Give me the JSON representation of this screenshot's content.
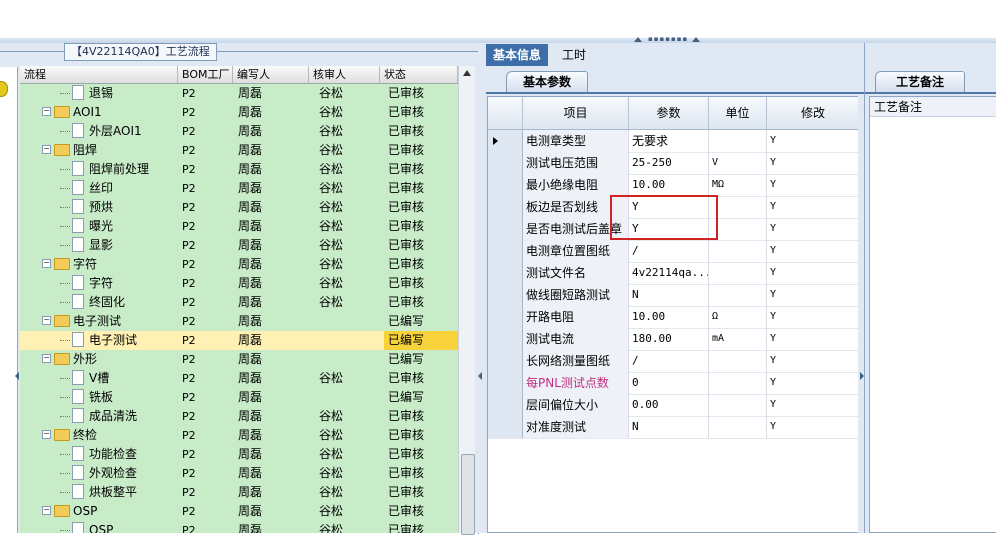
{
  "workflow": {
    "group_title": "【4V22114QA0】工艺流程",
    "columns": [
      "流程",
      "BOM工厂",
      "编写人",
      "核审人",
      "状态"
    ],
    "rows": [
      {
        "indent": 2,
        "kind": "doc",
        "name": "退锡",
        "bom": "P2",
        "writer": "周磊",
        "auditor": "谷松",
        "status": "已审核"
      },
      {
        "indent": 1,
        "kind": "folder",
        "name": "AOI1",
        "bom": "P2",
        "writer": "周磊",
        "auditor": "谷松",
        "status": "已审核"
      },
      {
        "indent": 2,
        "kind": "doc",
        "name": "外层AOI1",
        "bom": "P2",
        "writer": "周磊",
        "auditor": "谷松",
        "status": "已审核"
      },
      {
        "indent": 1,
        "kind": "folder",
        "name": "阻焊",
        "bom": "P2",
        "writer": "周磊",
        "auditor": "谷松",
        "status": "已审核"
      },
      {
        "indent": 2,
        "kind": "doc",
        "name": "阻焊前处理",
        "bom": "P2",
        "writer": "周磊",
        "auditor": "谷松",
        "status": "已审核"
      },
      {
        "indent": 2,
        "kind": "doc",
        "name": "丝印",
        "bom": "P2",
        "writer": "周磊",
        "auditor": "谷松",
        "status": "已审核"
      },
      {
        "indent": 2,
        "kind": "doc",
        "name": "预烘",
        "bom": "P2",
        "writer": "周磊",
        "auditor": "谷松",
        "status": "已审核"
      },
      {
        "indent": 2,
        "kind": "doc",
        "name": "曝光",
        "bom": "P2",
        "writer": "周磊",
        "auditor": "谷松",
        "status": "已审核"
      },
      {
        "indent": 2,
        "kind": "doc",
        "name": "显影",
        "bom": "P2",
        "writer": "周磊",
        "auditor": "谷松",
        "status": "已审核"
      },
      {
        "indent": 1,
        "kind": "folder",
        "name": "字符",
        "bom": "P2",
        "writer": "周磊",
        "auditor": "谷松",
        "status": "已审核"
      },
      {
        "indent": 2,
        "kind": "doc",
        "name": "字符",
        "bom": "P2",
        "writer": "周磊",
        "auditor": "谷松",
        "status": "已审核"
      },
      {
        "indent": 2,
        "kind": "doc",
        "name": "终固化",
        "bom": "P2",
        "writer": "周磊",
        "auditor": "谷松",
        "status": "已审核"
      },
      {
        "indent": 1,
        "kind": "folder",
        "name": "电子测试",
        "bom": "P2",
        "writer": "周磊",
        "auditor": "",
        "status": "已编写"
      },
      {
        "indent": 2,
        "kind": "doc",
        "name": "电子测试",
        "bom": "P2",
        "writer": "周磊",
        "auditor": "",
        "status": "已编写",
        "selected": true
      },
      {
        "indent": 1,
        "kind": "folder",
        "name": "外形",
        "bom": "P2",
        "writer": "周磊",
        "auditor": "",
        "status": "已编写"
      },
      {
        "indent": 2,
        "kind": "doc",
        "name": "V槽",
        "bom": "P2",
        "writer": "周磊",
        "auditor": "谷松",
        "status": "已审核"
      },
      {
        "indent": 2,
        "kind": "doc",
        "name": "铣板",
        "bom": "P2",
        "writer": "周磊",
        "auditor": "",
        "status": "已编写"
      },
      {
        "indent": 2,
        "kind": "doc",
        "name": "成品清洗",
        "bom": "P2",
        "writer": "周磊",
        "auditor": "谷松",
        "status": "已审核"
      },
      {
        "indent": 1,
        "kind": "folder",
        "name": "终检",
        "bom": "P2",
        "writer": "周磊",
        "auditor": "谷松",
        "status": "已审核"
      },
      {
        "indent": 2,
        "kind": "doc",
        "name": "功能检查",
        "bom": "P2",
        "writer": "周磊",
        "auditor": "谷松",
        "status": "已审核"
      },
      {
        "indent": 2,
        "kind": "doc",
        "name": "外观检查",
        "bom": "P2",
        "writer": "周磊",
        "auditor": "谷松",
        "status": "已审核"
      },
      {
        "indent": 2,
        "kind": "doc",
        "name": "烘板整平",
        "bom": "P2",
        "writer": "周磊",
        "auditor": "谷松",
        "status": "已审核"
      },
      {
        "indent": 1,
        "kind": "folder",
        "name": "OSP",
        "bom": "P2",
        "writer": "周磊",
        "auditor": "谷松",
        "status": "已审核"
      },
      {
        "indent": 2,
        "kind": "doc",
        "name": "OSP",
        "bom": "P2",
        "writer": "周磊",
        "auditor": "谷松",
        "status": "已审核"
      }
    ]
  },
  "tabs": {
    "basic_info": "基本信息",
    "work_hours": "工时"
  },
  "params": {
    "subtab": "基本参数",
    "columns": [
      "项目",
      "参数",
      "单位",
      "修改"
    ],
    "rows": [
      {
        "item": "电测章类型",
        "param": "无要求",
        "unit": "",
        "mod": "Y",
        "current": true,
        "cn": true
      },
      {
        "item": "测试电压范围",
        "param": "25-250",
        "unit": "V",
        "mod": "Y"
      },
      {
        "item": "最小绝缘电阻",
        "param": "10.00",
        "unit": "MΩ",
        "mod": "Y"
      },
      {
        "item": "板边是否划线",
        "param": "Y",
        "unit": "",
        "mod": "Y"
      },
      {
        "item": "是否电测试后盖章",
        "param": "Y",
        "unit": "",
        "mod": "Y"
      },
      {
        "item": "电测章位置图纸",
        "param": "/",
        "unit": "",
        "mod": "Y"
      },
      {
        "item": "测试文件名",
        "param": "4v22114qa...",
        "unit": "",
        "mod": "Y"
      },
      {
        "item": "做线圈短路测试",
        "param": "N",
        "unit": "",
        "mod": "Y"
      },
      {
        "item": "开路电阻",
        "param": "10.00",
        "unit": "Ω",
        "mod": "Y"
      },
      {
        "item": "测试电流",
        "param": "180.00",
        "unit": "mA",
        "mod": "Y"
      },
      {
        "item": "长网络测量图纸",
        "param": "/",
        "unit": "",
        "mod": "Y"
      },
      {
        "item": "每PNL测试点数",
        "param": "0",
        "unit": "",
        "mod": "Y",
        "pink": true
      },
      {
        "item": "层间偏位大小",
        "param": "0.00",
        "unit": "",
        "mod": "Y"
      },
      {
        "item": "对准度测试",
        "param": "N",
        "unit": "",
        "mod": "Y"
      }
    ]
  },
  "remarks": {
    "tab": "工艺备注",
    "header": "工艺备注"
  },
  "colors": {
    "tree_bg": "#c8ebc8",
    "selected_row": "#fff0b3",
    "active_tab": "#3d6ea8",
    "highlight_box": "#d22323"
  }
}
